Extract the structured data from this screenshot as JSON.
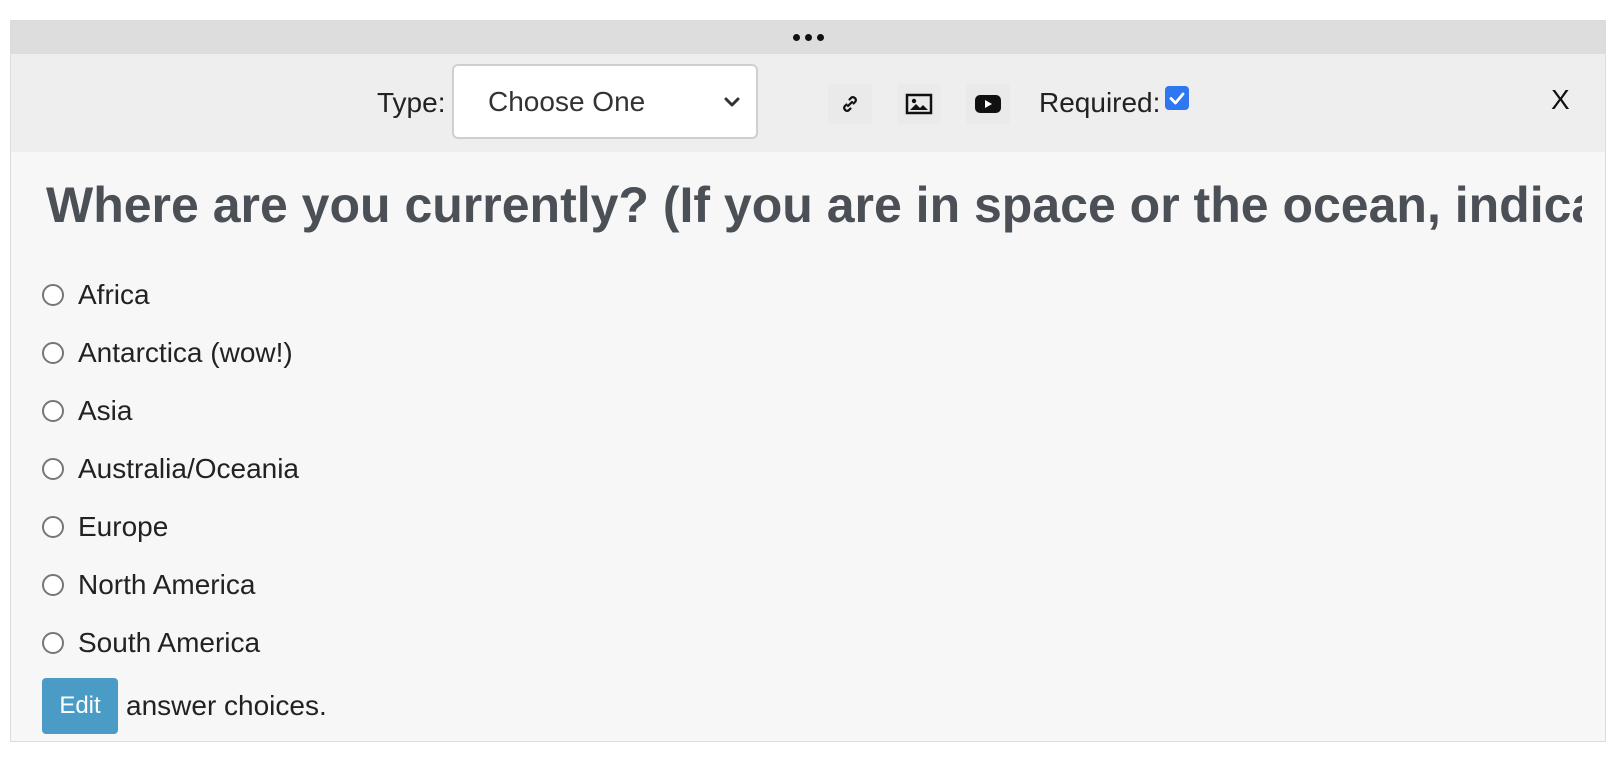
{
  "toolbar": {
    "type_label": "Type:",
    "type_selected": "Choose One",
    "link_icon": "link-icon",
    "image_icon": "image-icon",
    "video_icon": "youtube-icon",
    "required_label": "Required:",
    "required_checked": true,
    "close_label": "X"
  },
  "question": {
    "title": "Where are you currently? (If you are in space or the ocean, indicate your"
  },
  "choices": [
    "Africa",
    "Antarctica (wow!)",
    "Asia",
    "Australia/Oceania",
    "Europe",
    "North America",
    "South America"
  ],
  "edit": {
    "button_label": "Edit",
    "suffix_text": "answer choices."
  },
  "colors": {
    "accent_blue": "#4a9cc6",
    "checkbox_blue": "#2f76f2",
    "title_gray": "#4b5057"
  }
}
